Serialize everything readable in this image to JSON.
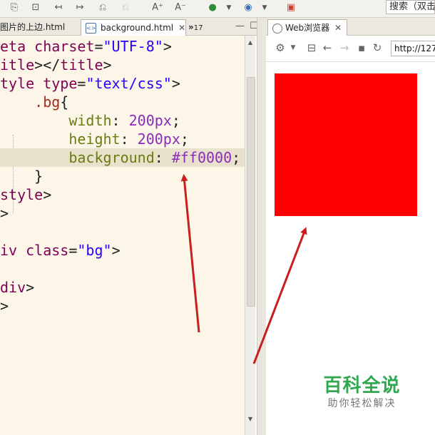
{
  "toolbar": {
    "search_text": "搜索（双击"
  },
  "editor_tabs": [
    {
      "label": "图片的上边.html"
    },
    {
      "label": "background.html",
      "active": true
    },
    {
      "label": "17",
      "prefix": "»"
    }
  ],
  "code": {
    "lines": [
      {
        "segments": [
          {
            "t": "eta ",
            "c": "kw"
          },
          {
            "t": "charset",
            "c": "kw"
          },
          {
            "t": "=",
            "c": "plain"
          },
          {
            "t": "\"UTF-8\"",
            "c": "str"
          },
          {
            "t": ">",
            "c": "plain"
          }
        ]
      },
      {
        "segments": [
          {
            "t": "itle",
            "c": "kw"
          },
          {
            "t": "></",
            "c": "plain"
          },
          {
            "t": "title",
            "c": "kw"
          },
          {
            "t": ">",
            "c": "plain"
          }
        ]
      },
      {
        "segments": [
          {
            "t": "tyle ",
            "c": "kw"
          },
          {
            "t": "type",
            "c": "kw"
          },
          {
            "t": "=",
            "c": "plain"
          },
          {
            "t": "\"text/css\"",
            "c": "str"
          },
          {
            "t": ">",
            "c": "plain"
          }
        ]
      },
      {
        "segments": [
          {
            "t": "    ",
            "c": "plain"
          },
          {
            "t": ".bg",
            "c": "cls"
          },
          {
            "t": "{",
            "c": "plain"
          }
        ]
      },
      {
        "segments": [
          {
            "t": "        ",
            "c": "plain"
          },
          {
            "t": "width",
            "c": "prop"
          },
          {
            "t": ": ",
            "c": "plain"
          },
          {
            "t": "200px",
            "c": "val"
          },
          {
            "t": ";",
            "c": "plain"
          }
        ]
      },
      {
        "segments": [
          {
            "t": "        ",
            "c": "plain"
          },
          {
            "t": "height",
            "c": "prop"
          },
          {
            "t": ": ",
            "c": "plain"
          },
          {
            "t": "200px",
            "c": "val"
          },
          {
            "t": ";",
            "c": "plain"
          }
        ]
      },
      {
        "segments": [
          {
            "t": "        ",
            "c": "plain"
          },
          {
            "t": "background",
            "c": "prop"
          },
          {
            "t": ": ",
            "c": "plain"
          },
          {
            "t": "#ff0000",
            "c": "val"
          },
          {
            "t": ";",
            "c": "plain"
          }
        ],
        "highlight": true
      },
      {
        "segments": [
          {
            "t": "    }",
            "c": "plain"
          }
        ]
      },
      {
        "segments": [
          {
            "t": "style",
            "c": "kw"
          },
          {
            "t": ">",
            "c": "plain"
          }
        ]
      },
      {
        "segments": [
          {
            "t": ">",
            "c": "plain"
          }
        ]
      },
      {
        "segments": [
          {
            "t": "",
            "c": "plain"
          }
        ]
      },
      {
        "segments": [
          {
            "t": "iv ",
            "c": "kw"
          },
          {
            "t": "class",
            "c": "kw"
          },
          {
            "t": "=",
            "c": "plain"
          },
          {
            "t": "\"bg\"",
            "c": "str"
          },
          {
            "t": ">",
            "c": "plain"
          }
        ]
      },
      {
        "segments": [
          {
            "t": "",
            "c": "plain"
          }
        ]
      },
      {
        "segments": [
          {
            "t": "div",
            "c": "kw"
          },
          {
            "t": ">",
            "c": "plain"
          }
        ]
      },
      {
        "segments": [
          {
            "t": ">",
            "c": "plain"
          }
        ]
      }
    ]
  },
  "browser": {
    "tab_label": "Web浏览器",
    "url": "http://127.",
    "box_color": "#ff0000"
  },
  "watermark": {
    "title": "百科全说",
    "subtitle": "助你轻松解决"
  },
  "colors": {
    "arrow": "#c81e1e",
    "editor_bg": "#fbf6e8",
    "highlight_line": "#e8e1cc"
  }
}
